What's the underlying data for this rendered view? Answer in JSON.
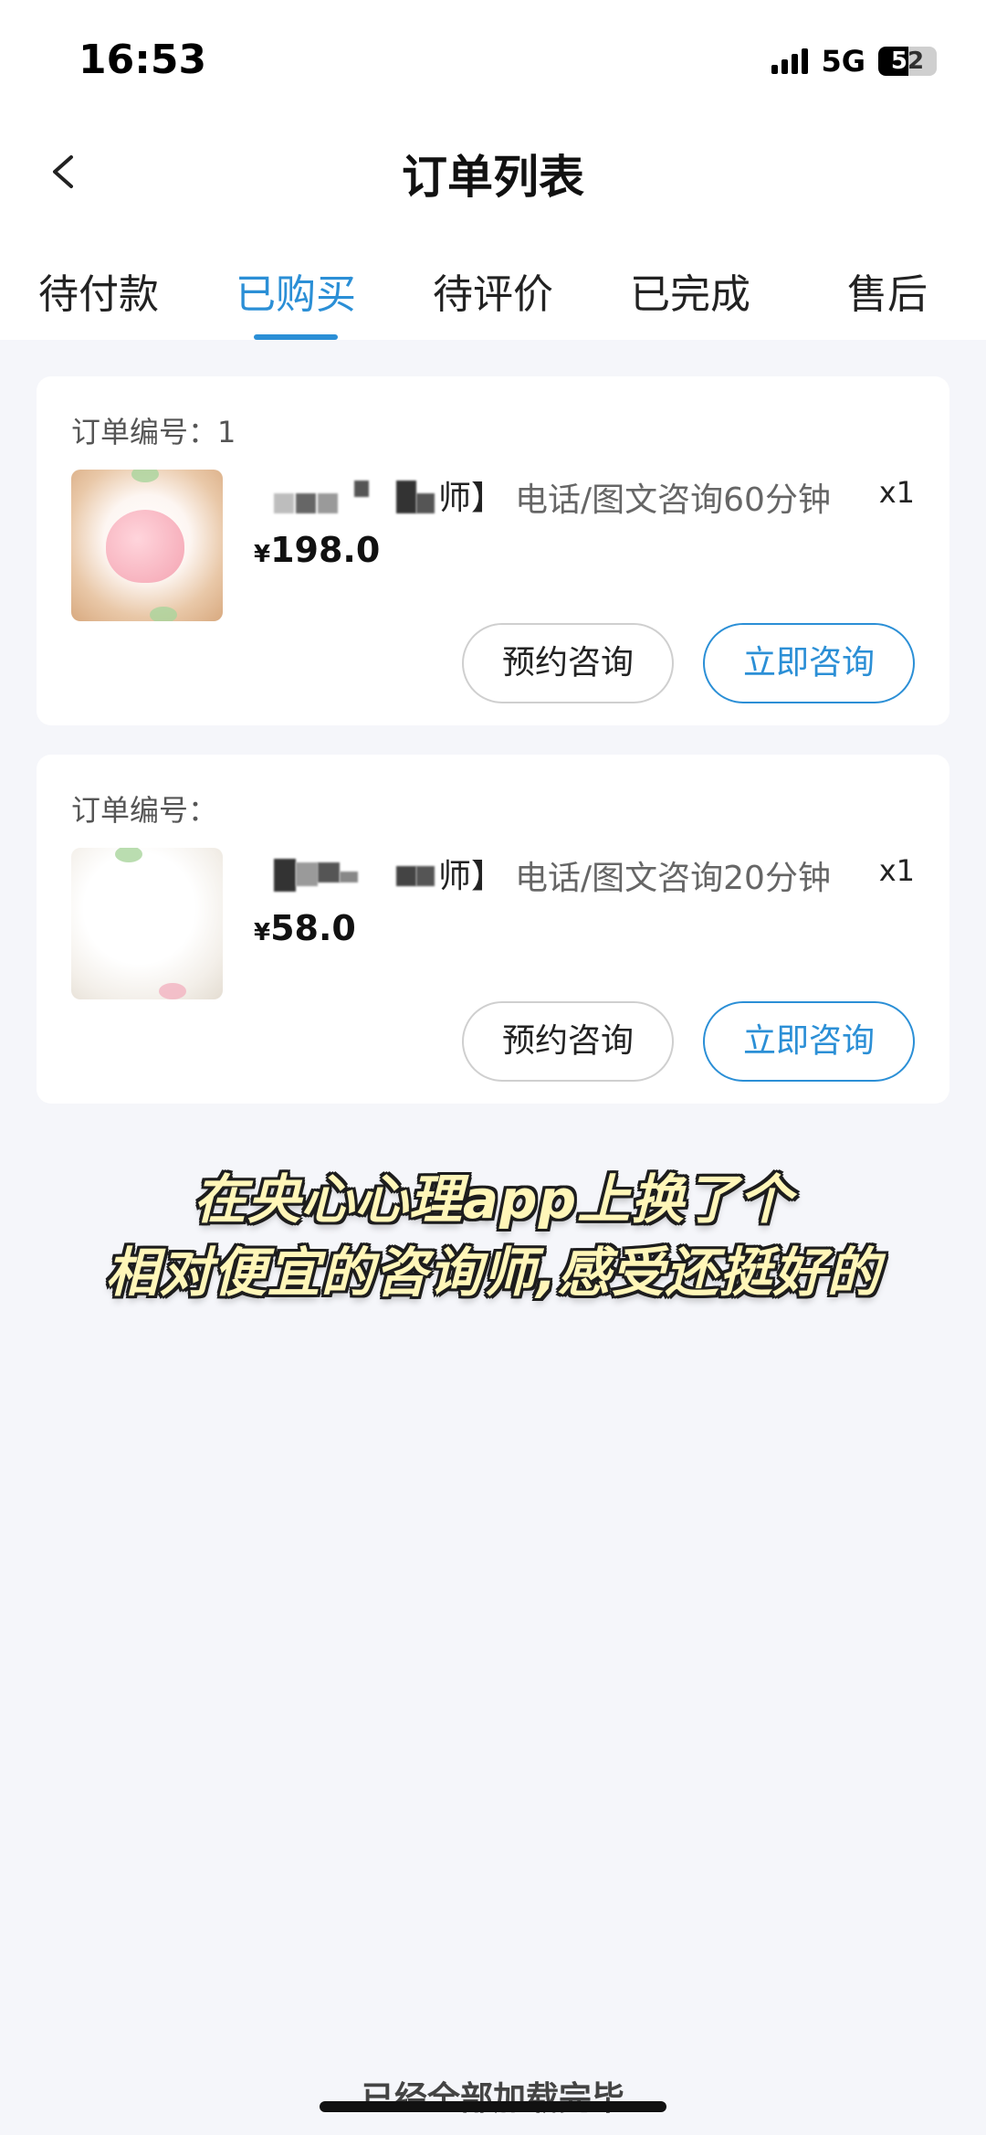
{
  "status_bar": {
    "time": "16:53",
    "network": "5G",
    "battery_level": "52",
    "battery_fraction": 0.52
  },
  "header": {
    "title": "订单列表",
    "back_icon": "chevron-left-icon"
  },
  "tabs": [
    {
      "label": "待付款",
      "active": false
    },
    {
      "label": "已购买",
      "active": true
    },
    {
      "label": "待评价",
      "active": false
    },
    {
      "label": "已完成",
      "active": false
    },
    {
      "label": "售后",
      "active": false
    }
  ],
  "orders": [
    {
      "order_no_label": "订单编号：",
      "order_no_value": "1",
      "name_suffix": "师】",
      "service": "电话/图文咨询60分钟",
      "quantity": "x1",
      "currency": "¥",
      "price": "198.0",
      "book_button": "预约咨询",
      "consult_button": "立即咨询"
    },
    {
      "order_no_label": "订单编号：",
      "order_no_value": "",
      "name_suffix": "师】",
      "service": "电话/图文咨询20分钟",
      "quantity": "x1",
      "currency": "¥",
      "price": "58.0",
      "book_button": "预约咨询",
      "consult_button": "立即咨询"
    }
  ],
  "caption": {
    "line1": "在央心心理app上换了个",
    "line2": "相对便宜的咨询师,感受还挺好的"
  },
  "footer": {
    "loaded_text": "已经全部加载完毕"
  },
  "colors": {
    "accent": "#2b8fd6",
    "background": "#f5f6fa",
    "caption_fill": "#fff6b8"
  }
}
